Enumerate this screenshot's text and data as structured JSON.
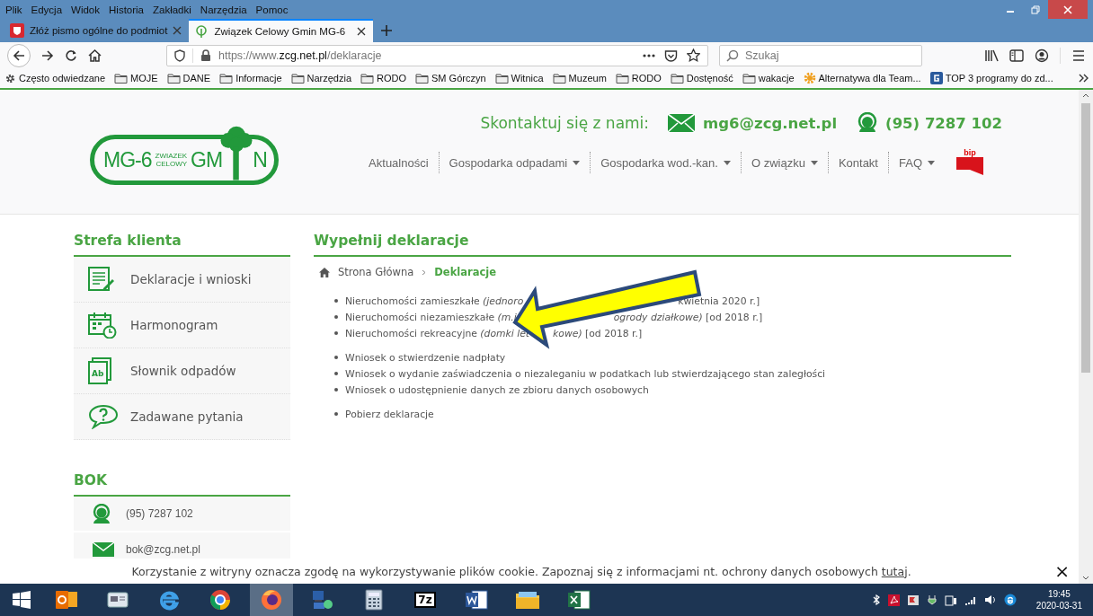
{
  "menu_bar": [
    "Plik",
    "Edycja",
    "Widok",
    "Historia",
    "Zakładki",
    "Narzędzia",
    "Pomoc"
  ],
  "tabs": [
    {
      "title": "Złóż pismo ogólne do podmiot",
      "kind": "emblem",
      "selected": false
    },
    {
      "title": "Związek Celowy Gmin MG-6",
      "kind": "tree",
      "selected": true
    }
  ],
  "address_bar": {
    "prefix": "https://www.",
    "domain": "zcg.net.pl",
    "path": "/deklaracje"
  },
  "search": {
    "placeholder": "Szukaj"
  },
  "bookmarks": [
    {
      "label": "Często odwiedzane",
      "kind": "gear"
    },
    {
      "label": "MOJE",
      "kind": "folder"
    },
    {
      "label": "DANE",
      "kind": "folder"
    },
    {
      "label": "Informacje",
      "kind": "folder"
    },
    {
      "label": "Narzędzia",
      "kind": "folder"
    },
    {
      "label": "RODO",
      "kind": "folder"
    },
    {
      "label": "SM Górczyn",
      "kind": "folder"
    },
    {
      "label": "Witnica",
      "kind": "folder"
    },
    {
      "label": "Muzeum",
      "kind": "folder"
    },
    {
      "label": "RODO",
      "kind": "folder"
    },
    {
      "label": "Dostęność",
      "kind": "folder"
    },
    {
      "label": "wakacje",
      "kind": "folder"
    },
    {
      "label": "Alternatywa dla Team...",
      "kind": "cog-site"
    },
    {
      "label": "TOP 3 programy do zd...",
      "kind": "g-site"
    }
  ],
  "page": {
    "logo": {
      "code": "MG-6",
      "line_1": "ZWIAZEK",
      "line_2": "CELOWY",
      "word_start": "GM",
      "word_end": "N"
    },
    "contact": {
      "label": "Skontaktuj się z nami:",
      "email": "mg6@zcg.net.pl",
      "phone": "(95) 7287 102"
    },
    "nav": [
      {
        "label": "Aktualności",
        "dropdown": false
      },
      {
        "label": "Gospodarka odpadami",
        "dropdown": true
      },
      {
        "label": "Gospodarka wod.-kan.",
        "dropdown": true
      },
      {
        "label": "O związku",
        "dropdown": true
      },
      {
        "label": "Kontakt",
        "dropdown": false
      },
      {
        "label": "FAQ",
        "dropdown": true
      }
    ],
    "bip": "bip",
    "sidebar": {
      "title": "Strefa klienta",
      "items": [
        {
          "label": "Deklaracje i wnioski",
          "kind": "document"
        },
        {
          "label": "Harmonogram",
          "kind": "calendar"
        },
        {
          "label": "Słownik odpadów",
          "kind": "book",
          "icon_text": "Ab"
        },
        {
          "label": "Zadawane pytania",
          "kind": "question"
        }
      ]
    },
    "bok": {
      "title": "BOK",
      "items": [
        {
          "label": "(95) 7287 102",
          "kind": "phone"
        },
        {
          "label": "bok@zcg.net.pl",
          "kind": "email"
        }
      ]
    },
    "content": {
      "title": "Wypełnij deklaracje",
      "breadcrumb": [
        {
          "label": "Strona Główna",
          "current": false
        },
        {
          "label": "Deklaracje",
          "current": true
        }
      ],
      "groups": [
        [
          {
            "before": "Nieruchomości zamieszkałe *(jednoro*",
            "after": "kwietnia 2020 r.]"
          },
          {
            "before": "Nieruchomości niezamieszkałe *(m.i*",
            "after": "*ogrody działkowe)* [od 2018 r.]"
          },
          {
            "before": "Nieruchomości rekreacyjne *(domki let*",
            "after": "*kowe)* [od 2018 r.]"
          }
        ],
        [
          {
            "before": "Wniosek o stwierdzenie nadpłaty"
          },
          {
            "before": "Wniosek o wydanie zaświadczenia o niezaleganiu w podatkach lub stwierdzającego stan zaległości"
          },
          {
            "before": "Wniosek o udostępnienie danych ze zbioru danych osobowych"
          }
        ],
        [
          {
            "before": "Pobierz deklaracje"
          }
        ]
      ]
    },
    "cookie_bar": {
      "text": "Korzystanie z witryny oznacza zgodę na wykorzystywanie plików cookie. Zapoznaj się z informacjami nt. ochrony danych osobowych",
      "link": "tutaj",
      "end": ".",
      "close": "×"
    }
  },
  "taskbar": {
    "apps": [
      {
        "kind": "outlook",
        "active": false
      },
      {
        "kind": "card",
        "active": false
      },
      {
        "kind": "ie",
        "active": false
      },
      {
        "kind": "chrome",
        "active": false
      },
      {
        "kind": "firefox",
        "active": true
      },
      {
        "kind": "network",
        "active": false
      },
      {
        "kind": "calculator",
        "active": false
      },
      {
        "kind": "archive",
        "label": "7z",
        "active": false
      },
      {
        "kind": "word",
        "active": false
      },
      {
        "kind": "explorer",
        "active": false
      },
      {
        "kind": "excel",
        "active": false
      }
    ],
    "time": "19:45",
    "date": "2020-03-31"
  }
}
